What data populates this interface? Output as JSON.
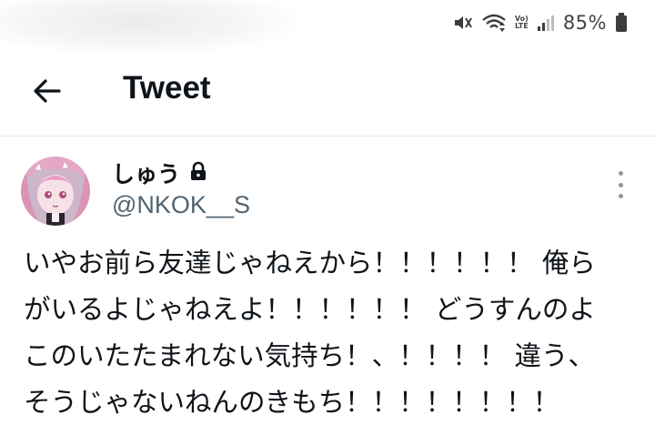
{
  "status_bar": {
    "battery_percent": "85%",
    "network_label": "Vo) LTE",
    "icons": [
      "mute-icon",
      "wifi-icon",
      "volte-icon",
      "signal-icon",
      "battery-icon"
    ]
  },
  "header": {
    "title": "Tweet",
    "back_icon": "arrow-left-icon"
  },
  "tweet": {
    "author_name": "しゅう",
    "handle": "@NKOK__S",
    "protected_icon": "lock-icon",
    "more_icon": "more-vertical-icon",
    "text_lines": [
      "いやお前ら友達じゃねえから！！！！！！ 俺ら",
      "がいるよじゃねえよ！！！！！！ どうすんのよ",
      "このいたたまれない気持ち！、！！！！ 違う、",
      "そうじゃないねんのきもち！！！！！！！！"
    ]
  },
  "colors": {
    "text_primary": "#0f1419",
    "text_secondary": "#536471",
    "divider": "#e6e6e6"
  }
}
